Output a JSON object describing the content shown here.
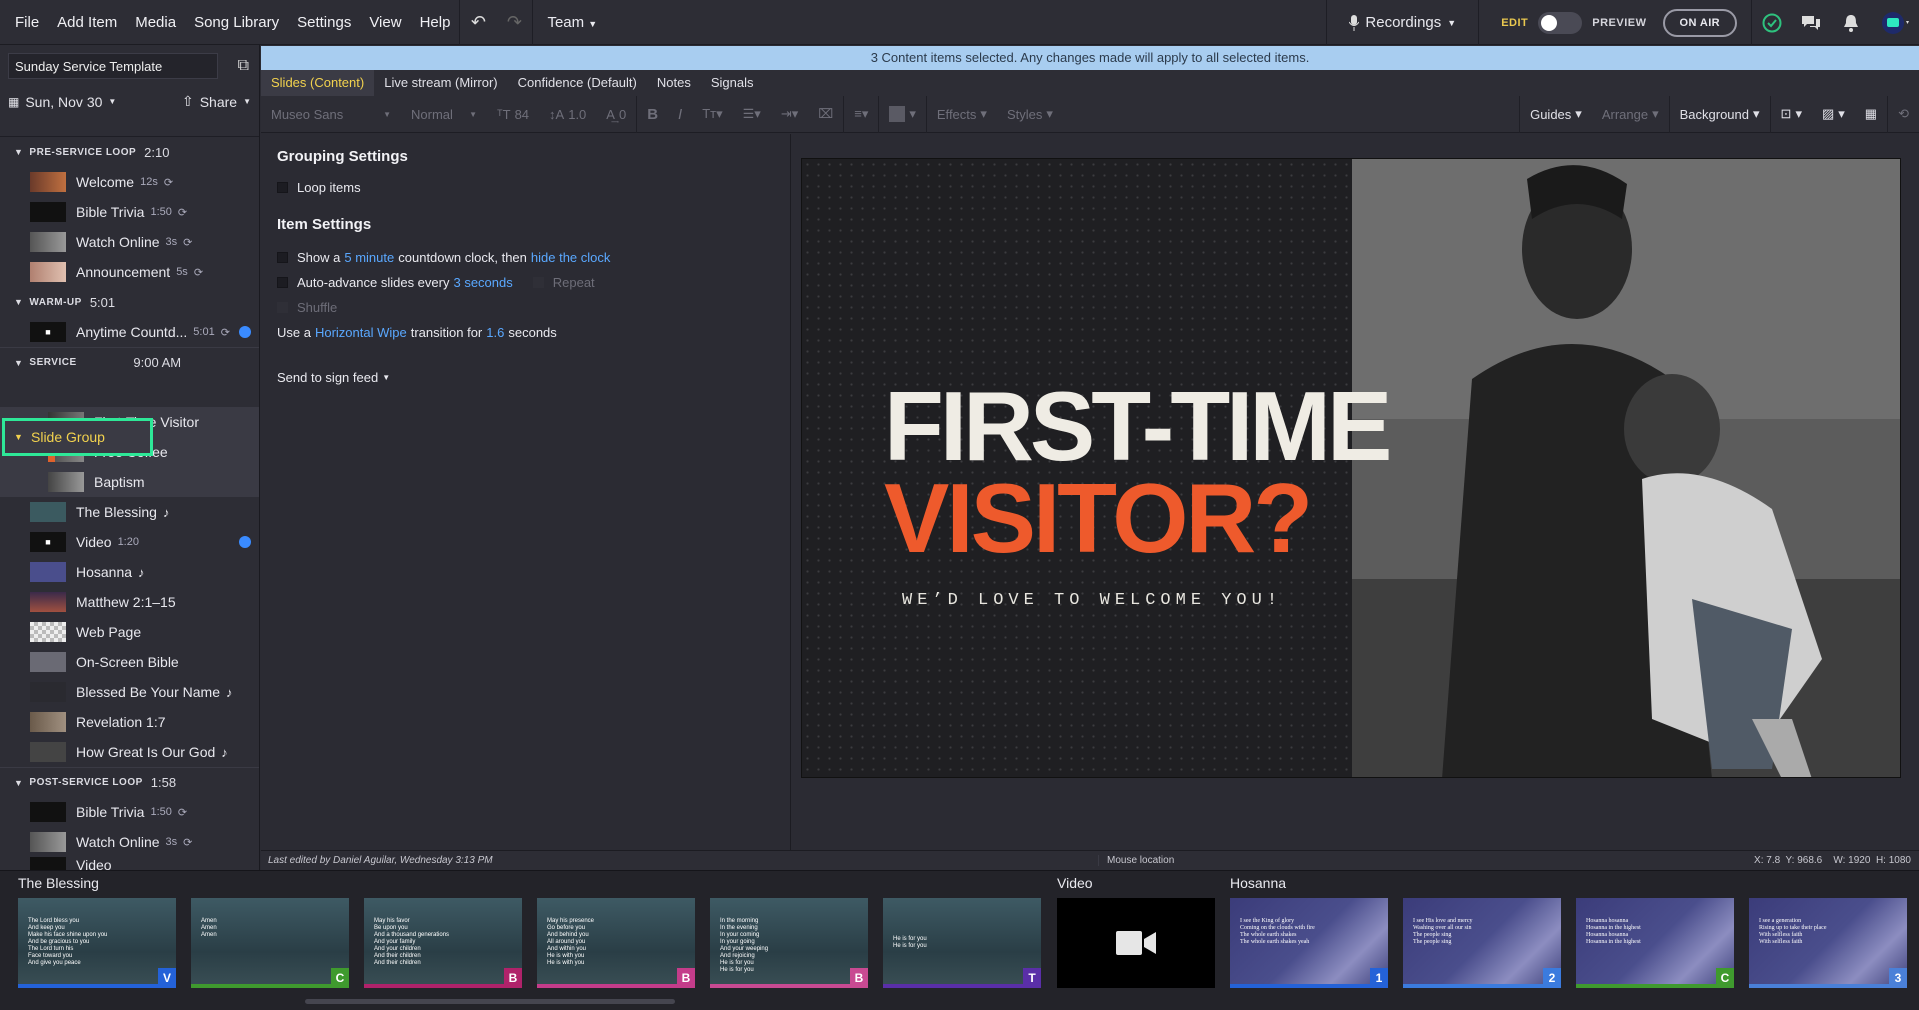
{
  "menu": [
    "File",
    "Add Item",
    "Media",
    "Song Library",
    "Settings",
    "View",
    "Help"
  ],
  "team_label": "Team",
  "recordings_label": "Recordings",
  "edit_label": "EDIT",
  "preview_label": "PREVIEW",
  "on_air_label": "ON AIR",
  "sidebar": {
    "template_name": "Sunday Service Template",
    "date": "Sun, Nov 30",
    "share": "Share",
    "pre_service": {
      "title": "PRE-SERVICE LOOP",
      "duration": "2:10",
      "items": [
        {
          "label": "Welcome",
          "meta": "12s"
        },
        {
          "label": "Bible Trivia",
          "meta": "1:50"
        },
        {
          "label": "Watch Online",
          "meta": "3s"
        },
        {
          "label": "Announcement",
          "meta": "5s"
        }
      ]
    },
    "warm_up": {
      "title": "WARM-UP",
      "duration": "5:01",
      "items": [
        {
          "label": "Anytime Countd...",
          "meta": "5:01"
        }
      ]
    },
    "service": {
      "title": "SERVICE",
      "time": "9:00 AM",
      "group": "Slide Group",
      "group_items": [
        "First-Time Visitor",
        "Free Coffee",
        "Baptism"
      ],
      "items": [
        {
          "label": "The Blessing",
          "meta": ""
        },
        {
          "label": "Video",
          "meta": "1:20"
        },
        {
          "label": "Hosanna",
          "meta": ""
        },
        {
          "label": "Matthew 2:1–15",
          "meta": ""
        },
        {
          "label": "Web Page",
          "meta": ""
        },
        {
          "label": "On-Screen Bible",
          "meta": ""
        },
        {
          "label": "Blessed Be Your Name",
          "meta": ""
        },
        {
          "label": "Revelation 1:7",
          "meta": ""
        },
        {
          "label": "How Great Is Our God",
          "meta": ""
        }
      ]
    },
    "post_service": {
      "title": "POST-SERVICE LOOP",
      "duration": "1:58",
      "items": [
        {
          "label": "Bible Trivia",
          "meta": "1:50"
        },
        {
          "label": "Watch Online",
          "meta": "3s"
        },
        {
          "label": "Video",
          "meta": ""
        }
      ]
    }
  },
  "banner": "3 Content items selected. Any changes made will apply to all selected items.",
  "tabs": [
    "Slides (Content)",
    "Live stream (Mirror)",
    "Confidence (Default)",
    "Notes",
    "Signals"
  ],
  "toolbar": {
    "font": "Museo Sans",
    "weight": "Normal",
    "size": "84",
    "line_height": "1.0",
    "spacing": "0",
    "effects": "Effects",
    "styles": "Styles",
    "guides": "Guides",
    "arrange": "Arrange",
    "background": "Background"
  },
  "settings": {
    "grouping_title": "Grouping Settings",
    "loop_items": "Loop items",
    "item_title": "Item Settings",
    "show_a": "Show a",
    "minutes": "5 minute",
    "countdown": "countdown clock, then",
    "hide_clock": "hide the clock",
    "auto_adv": "Auto-advance slides every",
    "seconds": "3 seconds",
    "repeat": "Repeat",
    "shuffle": "Shuffle",
    "use_a": "Use a",
    "transition": "Horizontal Wipe",
    "transition_for": "transition for",
    "dur": "1.6",
    "seconds_word": "seconds",
    "sign_feed": "Send to sign feed"
  },
  "slide": {
    "line1": "FIRST-TIME",
    "line2": "VISITOR?",
    "line3": "WE’D LOVE TO WELCOME YOU!"
  },
  "status": {
    "edited": "Last edited by Daniel Aguilar, Wednesday 3:13 PM",
    "mouse": "Mouse location",
    "coords": "X: 7.8  Y: 968.6    W: 1920  H: 1080"
  },
  "film": {
    "group_blessing": "The Blessing",
    "group_video": "Video",
    "group_hosanna": "Hosanna",
    "blessing_slides": [
      {
        "text": "The Lord bless you\nAnd keep you\nMake his face shine upon you\nAnd be gracious to you\nThe Lord turn his\nFace toward you\nAnd give you peace",
        "label": "V",
        "color": "#2462d8"
      },
      {
        "text": "Amen\nAmen\nAmen",
        "label": "C",
        "color": "#3f9a2e"
      },
      {
        "text": "May his favor\nBe upon you\nAnd a thousand generations\nAnd your family\nAnd your children\nAnd their children\nAnd their children",
        "label": "B",
        "color": "#b0226a"
      },
      {
        "text": "May his presence\nGo before you\nAnd behind you\nAll around you\nAnd within you\nHe is with you\nHe is with you",
        "label": "B",
        "color": "#c43c8a"
      },
      {
        "text": "In the morning\nIn the evening\nIn your coming\nIn your going\nAnd your weeping\nAnd rejoicing\nHe is for you\nHe is for you",
        "label": "B",
        "color": "#c84a92"
      },
      {
        "text": "He is for you\nHe is for you",
        "label": "T",
        "color": "#5a2fa8"
      }
    ],
    "hosanna_slides": [
      {
        "text": "I see the King of glory\nComing on the clouds with fire\nThe whole earth shakes\nThe whole earth shakes yeah",
        "label": "1",
        "color": "#2462d8"
      },
      {
        "text": "I see His love and mercy\nWashing over all our sin\nThe people sing\nThe people sing",
        "label": "2",
        "color": "#3b7bde"
      },
      {
        "text": "Hosanna hosanna\nHosanna in the highest\nHosanna hosanna\nHosanna in the highest",
        "label": "C",
        "color": "#3f9a2e"
      },
      {
        "text": "I see a generation\nRising up to take their place\nWith selfless faith\nWith selfless faith",
        "label": "3",
        "color": "#4a80d8"
      }
    ]
  }
}
